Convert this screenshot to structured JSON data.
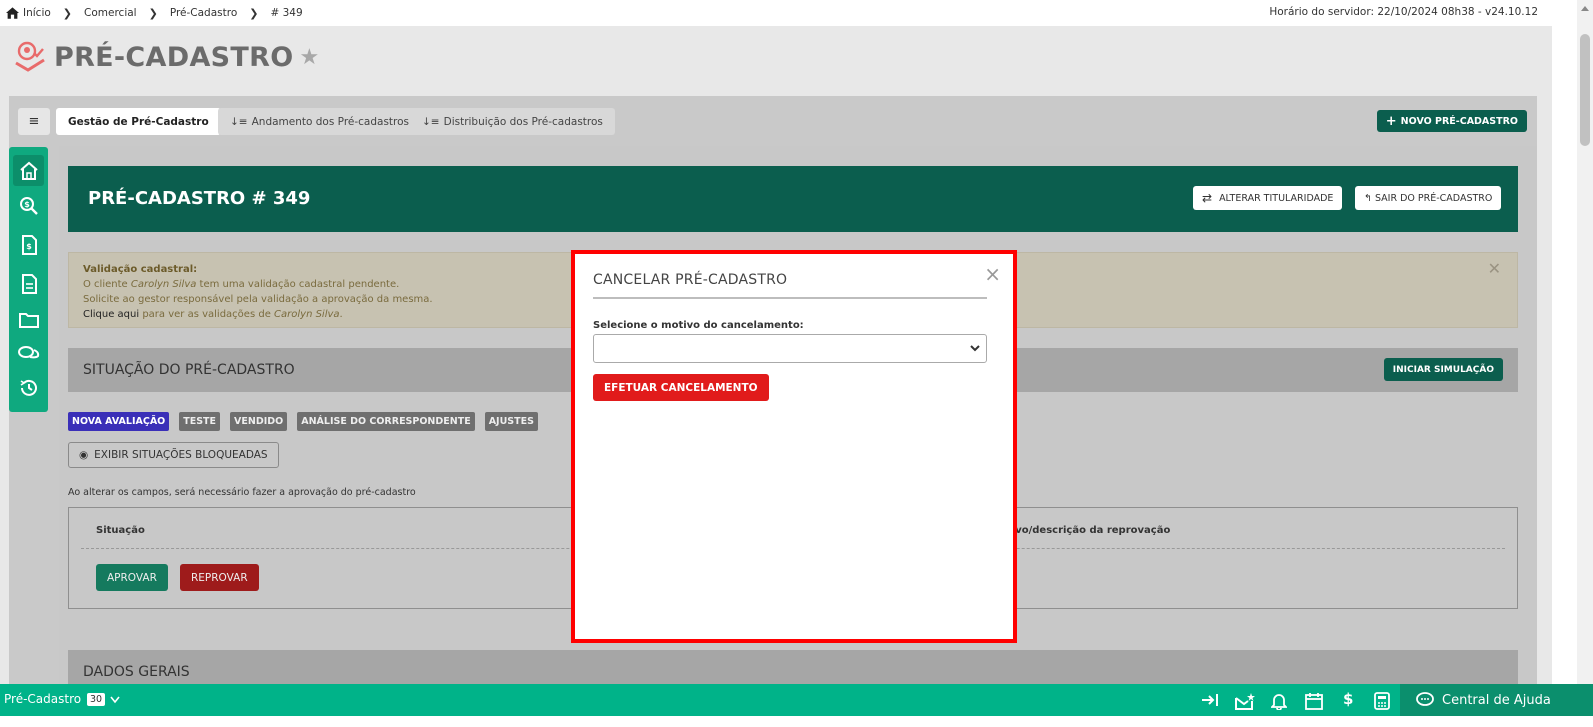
{
  "breadcrumb": [
    "Início",
    "Comercial",
    "Pré-Cadastro",
    "# 349"
  ],
  "server_time": "Horário do servidor: 22/10/2024 08h38 - v24.10.12",
  "page": {
    "title": "PRÉ-CADASTRO"
  },
  "tabs": [
    {
      "label": "Gestão de Pré-Cadastro"
    },
    {
      "label": "Andamento dos Pré-cadastros"
    },
    {
      "label": "Distribuição dos Pré-cadastros"
    }
  ],
  "new_button": "NOVO PRÉ-CADASTRO",
  "header": {
    "title": "PRÉ-CADASTRO # 349",
    "change_owner": "ALTERAR TITULARIDADE",
    "exit": "SAIR DO PRÉ-CADASTRO"
  },
  "alert": {
    "title": "Validação cadastral:",
    "line1_pre": "O cliente ",
    "line1_name": "Carolyn Silva",
    "line1_post": " tem uma validação cadastral pendente.",
    "line2": "Solicite ao gestor responsável pela validação a aprovação da mesma.",
    "link": "Clique aqui",
    "line3_post": " para ver as validações de ",
    "line3_name": "Carolyn Silva",
    "line3_end": "."
  },
  "situation": {
    "title": "SITUAÇÃO DO PRÉ-CADASTRO",
    "simulate": "INICIAR SIMULAÇÃO",
    "badges": [
      "NOVA AVALIAÇÃO",
      "TESTE",
      "VENDIDO",
      "ANÁLISE DO CORRESPONDENTE",
      "AJUSTES"
    ],
    "show_blocked": "EXIBIR SITUAÇÕES BLOQUEADAS",
    "note": "Ao alterar os campos, será necessário fazer a aprovação do pré-cadastro",
    "col_situation": "Situação",
    "col_reason": "tivo/descrição da reprovação",
    "approve": "APROVAR",
    "reject": "REPROVAR"
  },
  "general": {
    "title": "DADOS GERAIS"
  },
  "modal": {
    "title": "CANCELAR PRÉ-CADASTRO",
    "close": "×",
    "label": "Selecione o motivo do cancelamento:",
    "select_value": "",
    "submit": "EFETUAR CANCELAMENTO"
  },
  "bottom": {
    "module": "Pré-Cadastro",
    "count": "30",
    "help": "Central de Ajuda"
  },
  "colors": {
    "brand_dark": "#0b5e4e",
    "brand": "#00b389",
    "danger": "#e11b1b",
    "modal_outline": "#ff0000"
  }
}
